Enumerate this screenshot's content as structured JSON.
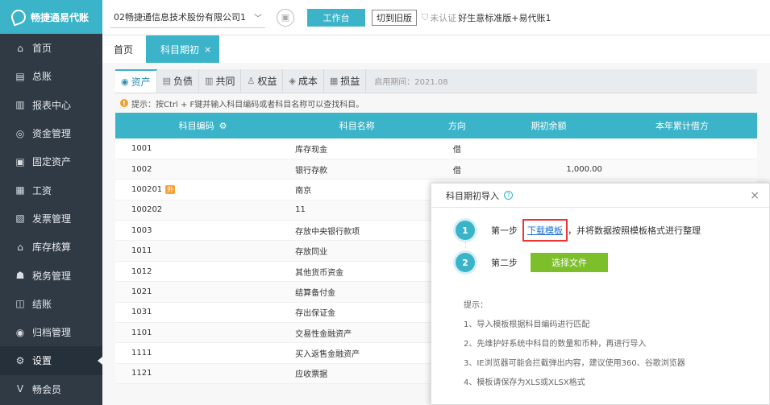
{
  "app": {
    "logo_text": "畅捷通易代账"
  },
  "sidebar": {
    "items": [
      {
        "label": "首页",
        "icon": "home-icon",
        "glyph": "⌂"
      },
      {
        "label": "总账",
        "icon": "ledger-icon",
        "glyph": "▤"
      },
      {
        "label": "报表中心",
        "icon": "report-icon",
        "glyph": "▥"
      },
      {
        "label": "资金管理",
        "icon": "fund-icon",
        "glyph": "◎"
      },
      {
        "label": "固定资产",
        "icon": "asset-icon",
        "glyph": "▣"
      },
      {
        "label": "工资",
        "icon": "salary-icon",
        "glyph": "▦"
      },
      {
        "label": "发票管理",
        "icon": "invoice-icon",
        "glyph": "▧"
      },
      {
        "label": "库存核算",
        "icon": "inventory-icon",
        "glyph": "⌂"
      },
      {
        "label": "税务管理",
        "icon": "tax-icon",
        "glyph": "☗"
      },
      {
        "label": "结账",
        "icon": "closing-icon",
        "glyph": "◫"
      },
      {
        "label": "归档管理",
        "icon": "archive-icon",
        "glyph": "◉"
      },
      {
        "label": "设置",
        "icon": "settings-icon",
        "glyph": "⚙"
      },
      {
        "label": "畅会员",
        "icon": "member-icon",
        "glyph": "V"
      }
    ],
    "active_index": 11
  },
  "topbar": {
    "company": "02畅捷通信息技术股份有限公司1",
    "workbench_label": "工作台",
    "old_version_label": "切到旧版",
    "cert_label": "未认证",
    "account_label": "好生意标准版+易代账1"
  },
  "tabs": {
    "home_label": "首页",
    "active_label": "科目期初",
    "close_glyph": "×"
  },
  "categories": {
    "items": [
      {
        "label": "资产",
        "icon": "asset-cat-icon",
        "glyph": "◉"
      },
      {
        "label": "负债",
        "icon": "liability-cat-icon",
        "glyph": "▤"
      },
      {
        "label": "共同",
        "icon": "common-cat-icon",
        "glyph": "▥"
      },
      {
        "label": "权益",
        "icon": "equity-cat-icon",
        "glyph": "♙"
      },
      {
        "label": "成本",
        "icon": "cost-cat-icon",
        "glyph": "◈"
      },
      {
        "label": "损益",
        "icon": "profit-cat-icon",
        "glyph": "▦"
      }
    ],
    "active_index": 0,
    "start_date": "启用期间：2021.08"
  },
  "hint": {
    "text": "提示：按Ctrl + F键并输入科目编码或者科目名称可以查找科目。"
  },
  "table": {
    "columns": [
      "科目编码",
      "科目名称",
      "方向",
      "期初余额",
      "本年累计借方"
    ],
    "rows": [
      {
        "code": "1001",
        "badge": "",
        "name": "库存现金",
        "dir": "借",
        "bal": ""
      },
      {
        "code": "1002",
        "badge": "",
        "name": "银行存款",
        "dir": "借",
        "bal": "1,000.00"
      },
      {
        "code": "100201",
        "badge": "外",
        "name": "南京",
        "dir": "",
        "bal": ""
      },
      {
        "code": "100202",
        "badge": "",
        "name": "11",
        "dir": "",
        "bal": ""
      },
      {
        "code": "1003",
        "badge": "",
        "name": "存放中央银行款项",
        "dir": "",
        "bal": ""
      },
      {
        "code": "1011",
        "badge": "",
        "name": "存放同业",
        "dir": "",
        "bal": ""
      },
      {
        "code": "1012",
        "badge": "",
        "name": "其他货币资金",
        "dir": "",
        "bal": ""
      },
      {
        "code": "1021",
        "badge": "",
        "name": "结算备付金",
        "dir": "",
        "bal": ""
      },
      {
        "code": "1031",
        "badge": "",
        "name": "存出保证金",
        "dir": "",
        "bal": ""
      },
      {
        "code": "1101",
        "badge": "",
        "name": "交易性金融资产",
        "dir": "",
        "bal": ""
      },
      {
        "code": "1111",
        "badge": "",
        "name": "买入返售金融资产",
        "dir": "",
        "bal": ""
      },
      {
        "code": "1121",
        "badge": "",
        "name": "应收票据",
        "dir": "",
        "bal": ""
      }
    ]
  },
  "modal": {
    "title": "科目期初导入",
    "close_glyph": "×",
    "step1": {
      "num": "1",
      "label": "第一步",
      "link": "下载模板",
      "suffix": "，并将数据按照模板格式进行整理"
    },
    "step2": {
      "num": "2",
      "label": "第二步",
      "button": "选择文件"
    },
    "tips": [
      "提示：",
      "1、导入模板根据科目编码进行匹配",
      "2、先维护好系统中科目的数量和币种，再进行导入",
      "3、IE浏览器可能会拦截弹出内容，建议使用360、谷歌浏览器",
      "4、模板请保存为XLS或XLSX格式"
    ]
  },
  "colors": {
    "accent": "#3bb4c9",
    "sidebar": "#2f3a45",
    "green_button": "#7cbf2a",
    "highlight_red": "#e33"
  }
}
